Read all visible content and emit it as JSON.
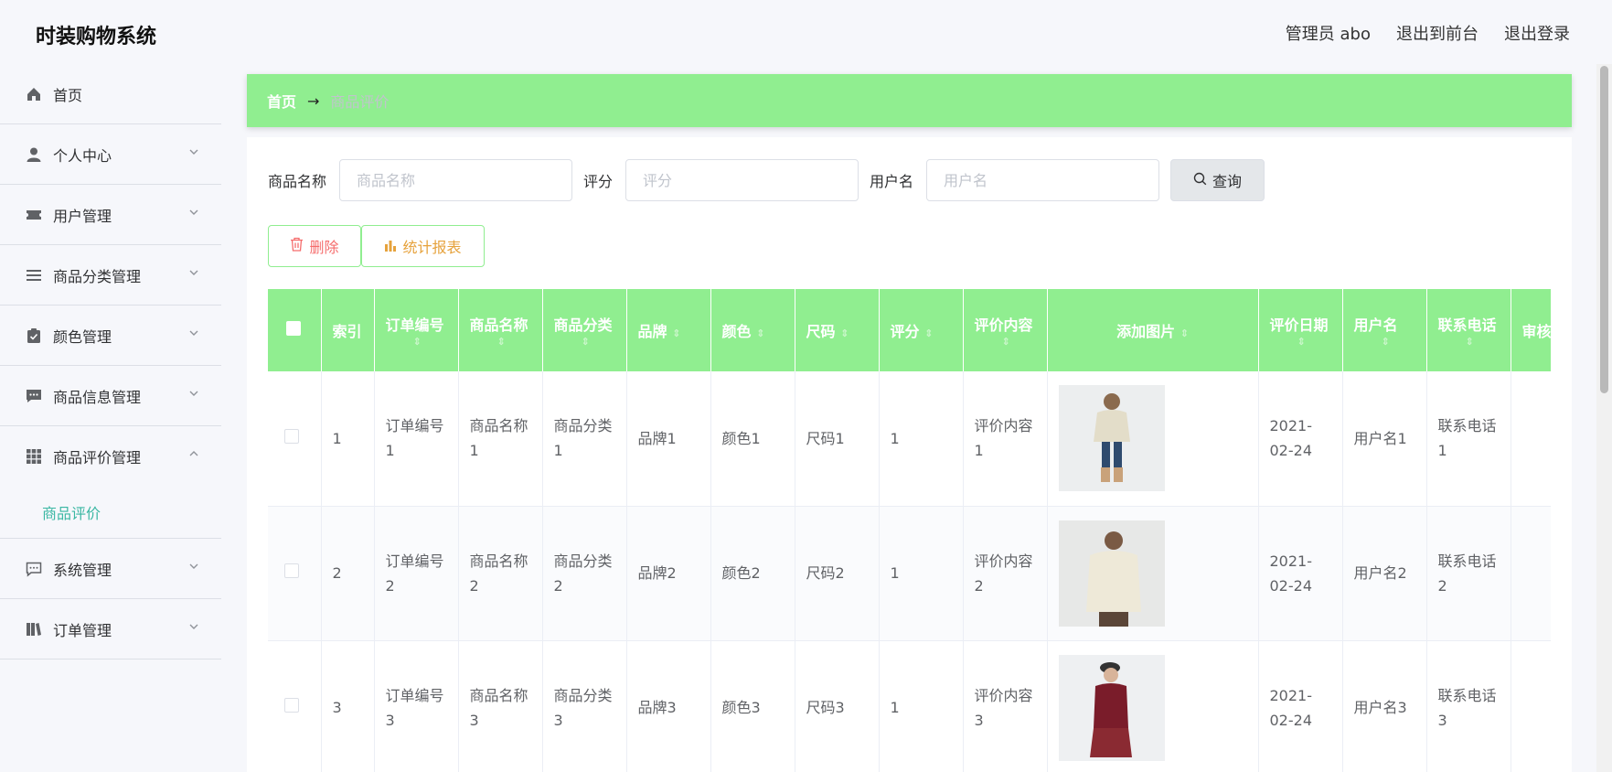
{
  "app": {
    "title": "时装购物系统"
  },
  "header": {
    "admin_label": "管理员 abo",
    "exit_front": "退出到前台",
    "logout": "退出登录"
  },
  "sidebar": {
    "items": [
      {
        "label": "首页",
        "icon": "home-icon"
      },
      {
        "label": "个人中心",
        "icon": "user-icon"
      },
      {
        "label": "用户管理",
        "icon": "ticket-icon"
      },
      {
        "label": "商品分类管理",
        "icon": "list-icon"
      },
      {
        "label": "颜色管理",
        "icon": "clipboard-icon"
      },
      {
        "label": "商品信息管理",
        "icon": "message-icon"
      },
      {
        "label": "商品评价管理",
        "icon": "grid-icon"
      },
      {
        "label": "系统管理",
        "icon": "chat-icon"
      },
      {
        "label": "订单管理",
        "icon": "book-icon"
      }
    ],
    "active_sub": "商品评价"
  },
  "breadcrumb": {
    "home": "首页",
    "arrow": "→",
    "current": "商品评价"
  },
  "search": {
    "product_label": "商品名称",
    "product_placeholder": "商品名称",
    "score_label": "评分",
    "score_placeholder": "评分",
    "user_label": "用户名",
    "user_placeholder": "用户名",
    "query_button": "查询"
  },
  "actions": {
    "delete": "删除",
    "report": "统计报表"
  },
  "table": {
    "headers": [
      "索引",
      "订单编号",
      "商品名称",
      "商品分类",
      "品牌",
      "颜色",
      "尺码",
      "评分",
      "评价内容",
      "添加图片",
      "评价日期",
      "用户名",
      "联系电话",
      "审核"
    ],
    "sort_mark": "⇕",
    "rows": [
      {
        "index": "1",
        "order": "订单编号1",
        "name": "商品名称1",
        "category": "商品分类1",
        "brand": "品牌1",
        "color": "颜色1",
        "size": "尺码1",
        "score": "1",
        "content": "评价内容1",
        "date": "2021-02-24",
        "user": "用户名1",
        "phone": "联系电话1"
      },
      {
        "index": "2",
        "order": "订单编号2",
        "name": "商品名称2",
        "category": "商品分类2",
        "brand": "品牌2",
        "color": "颜色2",
        "size": "尺码2",
        "score": "1",
        "content": "评价内容2",
        "date": "2021-02-24",
        "user": "用户名2",
        "phone": "联系电话2"
      },
      {
        "index": "3",
        "order": "订单编号3",
        "name": "商品名称3",
        "category": "商品分类3",
        "brand": "品牌3",
        "color": "颜色3",
        "size": "尺码3",
        "score": "1",
        "content": "评价内容3",
        "date": "2021-02-24",
        "user": "用户名3",
        "phone": "联系电话3"
      }
    ]
  },
  "colors": {
    "accent": "#90ee90",
    "active_sub": "#3ab7a3",
    "danger": "#f56c6c",
    "warning": "#e6a23c"
  }
}
